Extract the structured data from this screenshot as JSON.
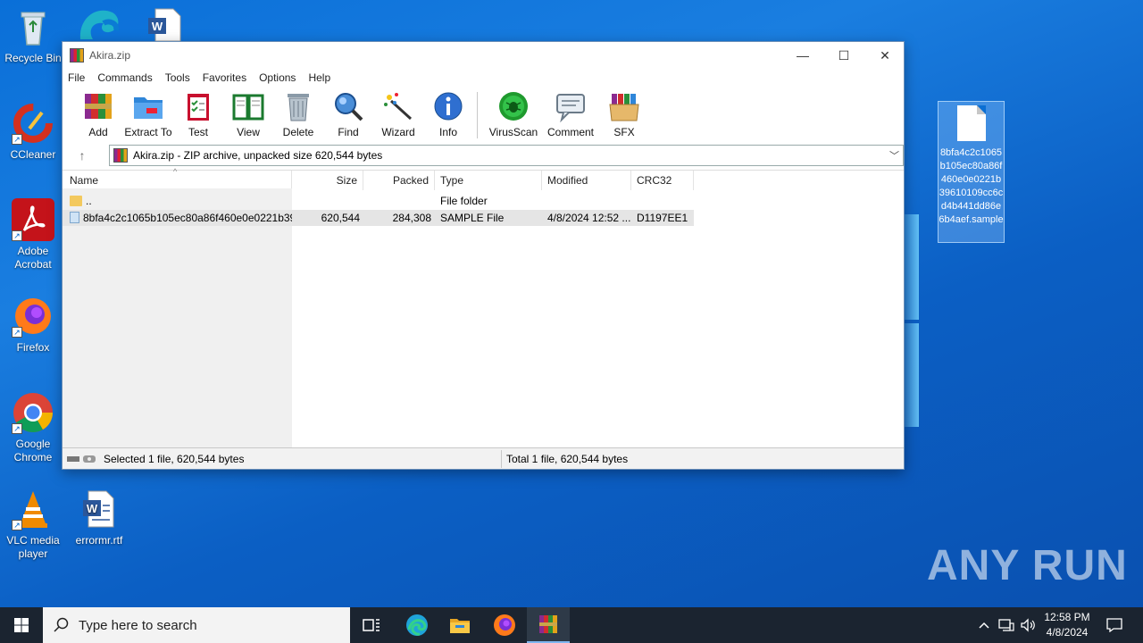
{
  "desktop": {
    "icons": [
      {
        "label": "Recycle Bin",
        "icon": "recycle-bin-icon"
      },
      {
        "label": "CCleaner",
        "icon": "ccleaner-icon"
      },
      {
        "label": "Adobe Acrobat",
        "icon": "adobe-acrobat-icon"
      },
      {
        "label": "Firefox",
        "icon": "firefox-icon"
      },
      {
        "label": "Google Chrome",
        "icon": "chrome-icon"
      },
      {
        "label": "VLC media player",
        "icon": "vlc-icon"
      },
      {
        "label": "errormr.rtf",
        "icon": "word-document-icon"
      }
    ],
    "selected_file_label": "8bfa4c2c1065b105ec80a86f460e0e0221b39610109cc6cd4b441dd86e6b4aef.sample",
    "watermark": "ANY RUN"
  },
  "window": {
    "title": "Akira.zip",
    "controls": {
      "minimize": "—",
      "maximize": "☐",
      "close": "✕"
    },
    "menu": [
      "File",
      "Commands",
      "Tools",
      "Favorites",
      "Options",
      "Help"
    ],
    "toolbar": [
      {
        "label": "Add",
        "icon": "add-archive-icon"
      },
      {
        "label": "Extract To",
        "icon": "extract-folder-icon"
      },
      {
        "label": "Test",
        "icon": "test-clipboard-icon"
      },
      {
        "label": "View",
        "icon": "view-book-icon"
      },
      {
        "label": "Delete",
        "icon": "trash-icon"
      },
      {
        "label": "Find",
        "icon": "find-magnifier-icon"
      },
      {
        "label": "Wizard",
        "icon": "wizard-wand-icon"
      },
      {
        "label": "Info",
        "icon": "info-icon"
      },
      {
        "label": "VirusScan",
        "icon": "virus-scan-icon"
      },
      {
        "label": "Comment",
        "icon": "comment-icon"
      },
      {
        "label": "SFX",
        "icon": "sfx-box-icon"
      }
    ],
    "address": "Akira.zip - ZIP archive, unpacked size 620,544 bytes",
    "columns": [
      "Name",
      "Size",
      "Packed",
      "Type",
      "Modified",
      "CRC32"
    ],
    "rows": [
      {
        "name": "..",
        "size": "",
        "packed": "",
        "type": "File folder",
        "modified": "",
        "crc": ""
      },
      {
        "name": "8bfa4c2c1065b105ec80a86f460e0e0221b39...",
        "size": "620,544",
        "packed": "284,308",
        "type": "SAMPLE File",
        "modified": "4/8/2024 12:52 ...",
        "crc": "D1197EE1"
      }
    ],
    "status_left": "Selected 1 file, 620,544 bytes",
    "status_right": "Total 1 file, 620,544 bytes"
  },
  "taskbar": {
    "search_placeholder": "Type here to search",
    "time": "12:58 PM",
    "date": "4/8/2024",
    "pinned": [
      "task-view-icon",
      "edge-icon",
      "file-explorer-icon",
      "firefox-icon",
      "winrar-icon"
    ]
  }
}
